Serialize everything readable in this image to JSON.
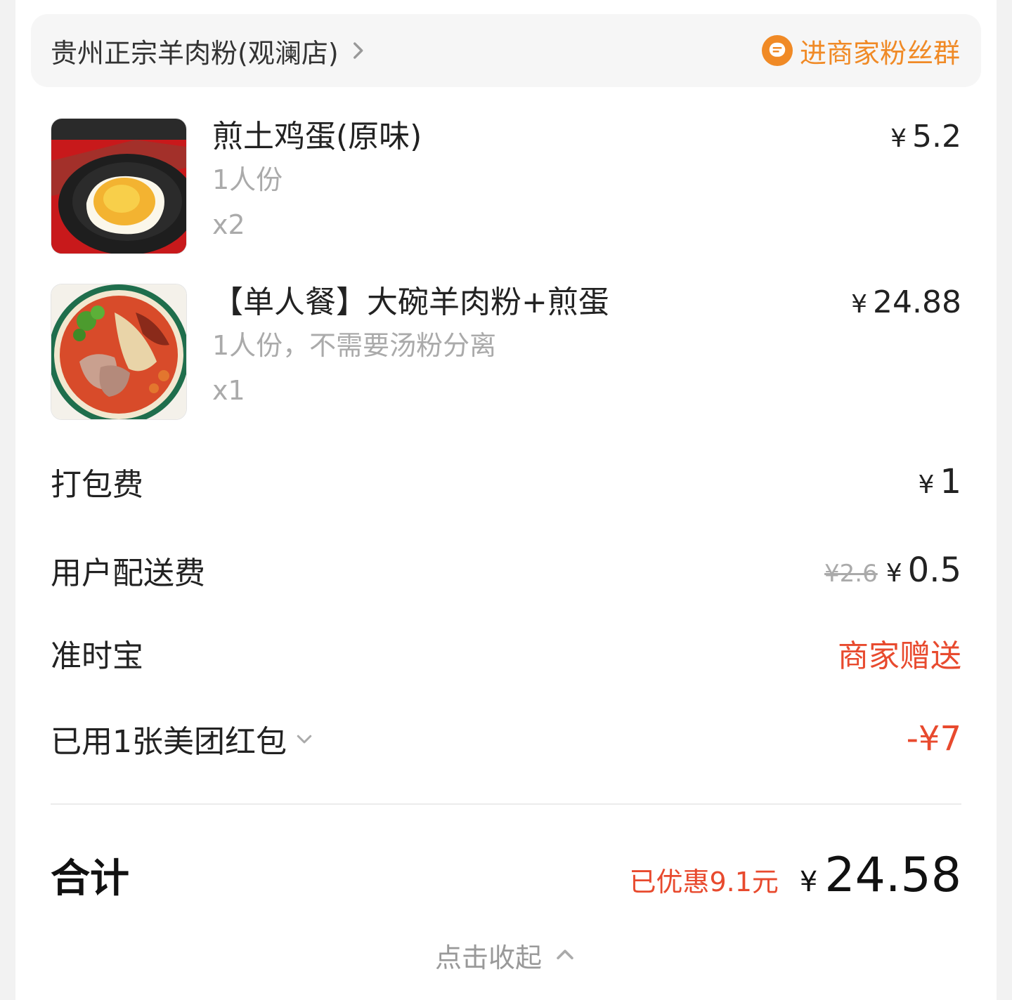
{
  "store": {
    "name": "贵州正宗羊肉粉(观澜店)",
    "fans_group_label": "进商家粉丝群"
  },
  "items": [
    {
      "title": "煎土鸡蛋(原味)",
      "spec": "1人份",
      "qty": "x2",
      "currency": "¥",
      "price": "5.2",
      "image": "fried-egg-photo"
    },
    {
      "title": "【单人餐】大碗羊肉粉+煎蛋",
      "spec": "1人份，不需要汤粉分离",
      "qty": "x1",
      "currency": "¥",
      "price": "24.88",
      "image": "mutton-noodle-photo"
    }
  ],
  "fees": {
    "packing": {
      "label": "打包费",
      "currency": "¥",
      "value": "1"
    },
    "delivery": {
      "label": "用户配送费",
      "original": "¥2.6",
      "currency": "¥",
      "value": "0.5"
    },
    "ontime": {
      "label": "准时宝",
      "value": "商家赠送"
    },
    "coupon": {
      "label": "已用1张美团红包",
      "value": "-¥7"
    }
  },
  "total": {
    "label": "合计",
    "saved": "已优惠9.1元",
    "currency": "¥",
    "amount": "24.58"
  },
  "collapse_label": "点击收起",
  "colors": {
    "accent_orange": "#f08a26",
    "discount_red": "#e84a2e"
  }
}
